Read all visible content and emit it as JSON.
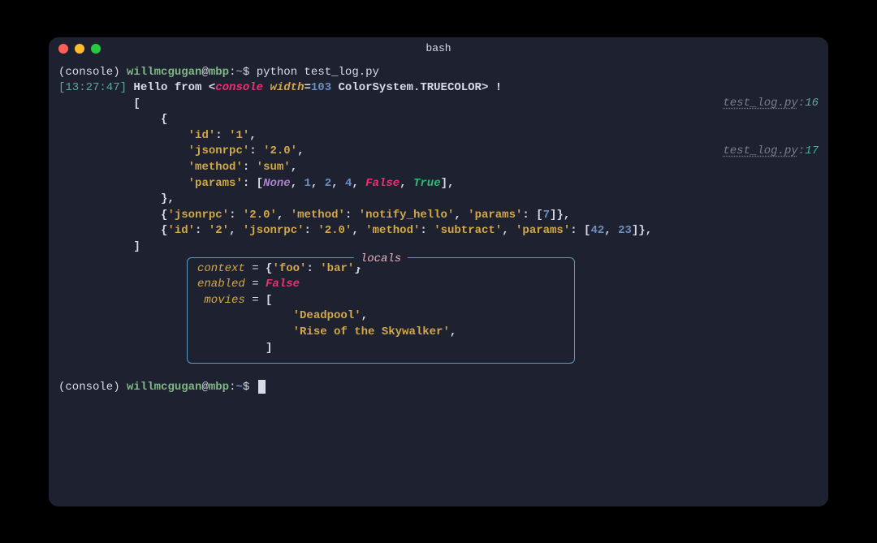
{
  "titlebar": {
    "title": "bash"
  },
  "prompt": {
    "venv": "(console)",
    "user": "willmcgugan",
    "host": "mbp",
    "path": "~",
    "sym": "$"
  },
  "cmd": "python test_log.py",
  "log": {
    "timestamp": "[13:27:47]",
    "hello_before": "Hello from ",
    "console_kw": "console",
    "width_kw": "width",
    "width_val": "103",
    "colorsystem": " ColorSystem",
    "truecolor": "TRUECOLOR",
    "hello_after": " !",
    "source_file": "test_log.py",
    "line_a": "16",
    "line_b": "17"
  },
  "data": {
    "id1": "'id'",
    "id1v": "'1'",
    "jsonrpc": "'jsonrpc'",
    "jsonrpcv": "'2.0'",
    "method": "'method'",
    "sum": "'sum'",
    "params": "'params'",
    "none": "None",
    "n1": "1",
    "n2": "2",
    "n4": "4",
    "false": "False",
    "true": "True",
    "notify": "'notify_hello'",
    "n7": "7",
    "id2": "'2'",
    "subtract": "'subtract'",
    "n42": "42",
    "n23": "23"
  },
  "locals": {
    "title": "locals",
    "context": "context",
    "foo": "'foo'",
    "bar": "'bar'",
    "enabled": "enabled",
    "movies": "movies",
    "deadpool": "'Deadpool'",
    "rise": "'Rise of the Skywalker'"
  }
}
